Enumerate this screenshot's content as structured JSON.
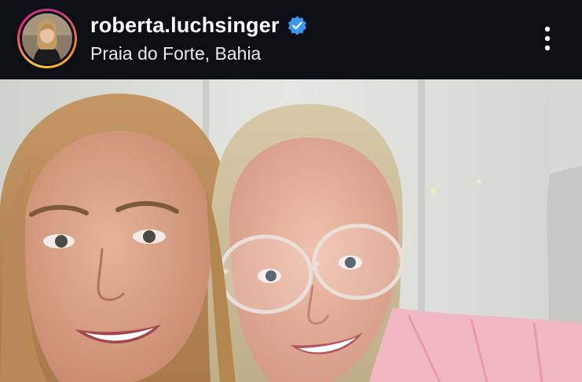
{
  "post": {
    "username": "roberta.luchsinger",
    "location": "Praia do Forte, Bahia",
    "verified": true,
    "verified_badge_color": "#3897f0",
    "avatar_icon": "profile-avatar",
    "menu_icon": "more-vertical-icon"
  },
  "colors": {
    "header_background": "#0c0f14",
    "text_primary": "#ffffff",
    "story_ring_gradient": [
      "#f9ce34",
      "#ee2a7b",
      "#c13584",
      "#f58529"
    ]
  }
}
